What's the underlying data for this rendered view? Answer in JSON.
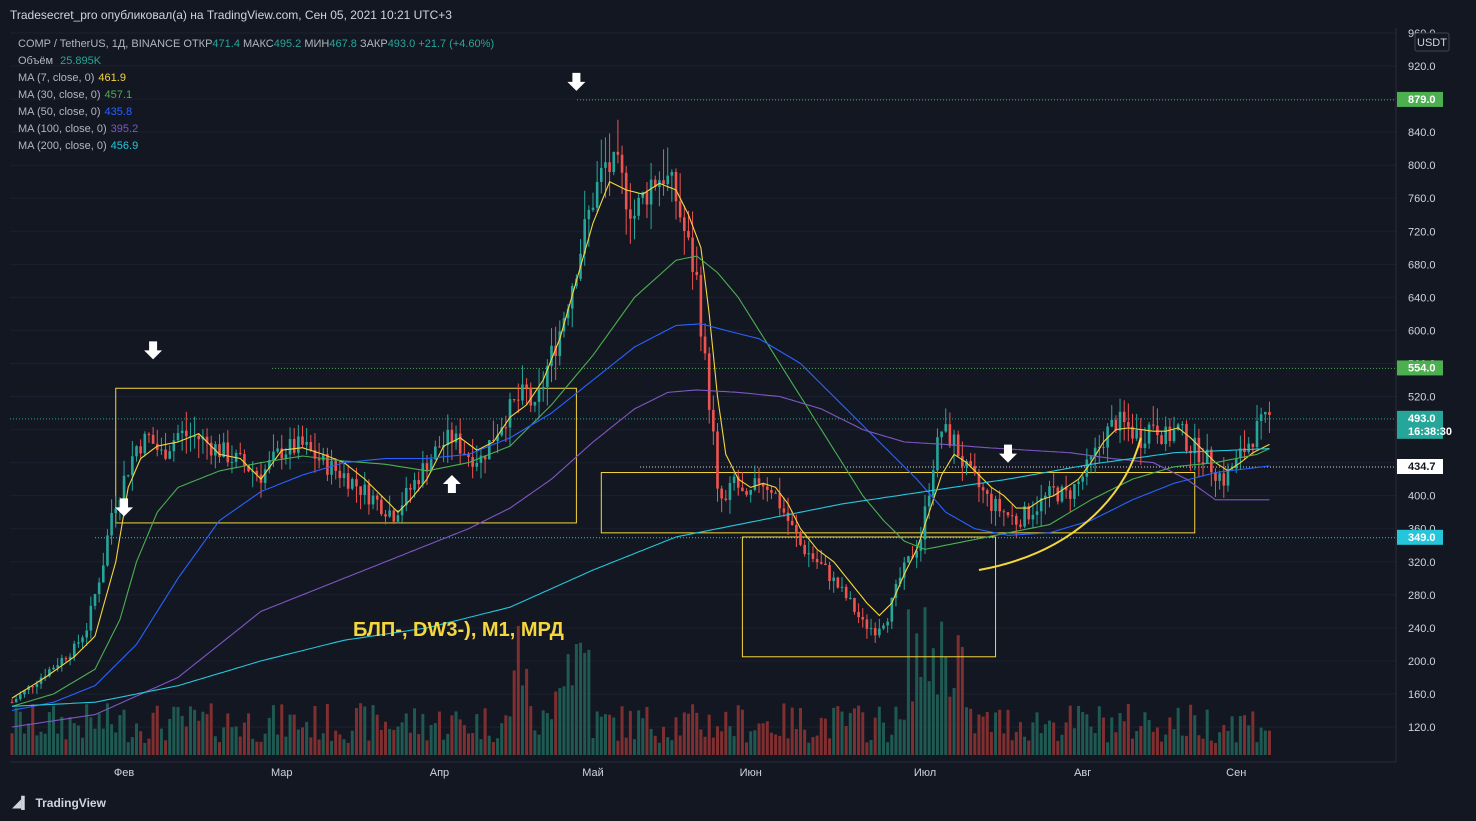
{
  "header": {
    "published": "Tradesecret_pro опубликовал(а) на TradingView.com, Сен 05, 2021 10:21 UTC+3"
  },
  "legend": {
    "symbol": "COMP / TetherUS, 1Д, BINANCE",
    "open_label": "ОТКР",
    "open": "471.4",
    "high_label": "МАКС",
    "high": "495.2",
    "low_label": "МИН",
    "low": "467.8",
    "close_label": "ЗАКР",
    "close": "493.0",
    "change": "+21.7 (+4.60%)",
    "volume_label": "Объём",
    "volume": "25.895K",
    "ma": [
      {
        "label": "MA (7, close, 0)",
        "value": "461.9",
        "color": "#f5d63d"
      },
      {
        "label": "MA (30, close, 0)",
        "value": "457.1",
        "color": "#4caf50"
      },
      {
        "label": "MA (50, close, 0)",
        "value": "435.8",
        "color": "#2962ff"
      },
      {
        "label": "MA (100, close, 0)",
        "value": "395.2",
        "color": "#7e57c2"
      },
      {
        "label": "MA (200, close, 0)",
        "value": "456.9",
        "color": "#26c6da"
      }
    ]
  },
  "annotation_text": "БЛП-, DW3-), M1, МРД",
  "footer": {
    "brand": "TradingView"
  },
  "chart_data": {
    "type": "candlestick",
    "currency": "USDT",
    "ylim": [
      90,
      960
    ],
    "y_ticks": [
      960,
      920,
      880,
      840,
      800,
      760,
      720,
      680,
      640,
      600,
      560,
      520,
      480,
      440,
      400,
      360,
      320,
      280,
      240,
      200,
      160,
      120
    ],
    "x_ticks": [
      "Фев",
      "Мар",
      "Апр",
      "Май",
      "Июн",
      "Июл",
      "Авг",
      "Сен"
    ],
    "price_labels": [
      {
        "value": "879.0",
        "color": "#4caf50"
      },
      {
        "value": "554.0",
        "color": "#4caf50"
      },
      {
        "value": "493.0",
        "sub": "16:38:30",
        "color": "#26a69a"
      },
      {
        "value": "434.7",
        "color": "#ffffff"
      },
      {
        "value": "349.0",
        "color": "#26c6da"
      }
    ],
    "horizontal_levels": [
      879,
      554,
      493,
      434.7,
      349
    ],
    "price_path": [
      [
        0,
        150
      ],
      [
        8,
        185
      ],
      [
        15,
        215
      ],
      [
        18,
        240
      ],
      [
        22,
        320
      ],
      [
        24,
        380
      ],
      [
        27,
        420
      ],
      [
        30,
        460
      ],
      [
        33,
        470
      ],
      [
        36,
        450
      ],
      [
        40,
        475
      ],
      [
        45,
        470
      ],
      [
        50,
        455
      ],
      [
        55,
        440
      ],
      [
        60,
        425
      ],
      [
        65,
        455
      ],
      [
        70,
        460
      ],
      [
        75,
        440
      ],
      [
        80,
        425
      ],
      [
        85,
        405
      ],
      [
        90,
        385
      ],
      [
        92,
        378
      ],
      [
        95,
        400
      ],
      [
        100,
        440
      ],
      [
        103,
        460
      ],
      [
        106,
        470
      ],
      [
        110,
        450
      ],
      [
        113,
        445
      ],
      [
        118,
        490
      ],
      [
        121,
        510
      ],
      [
        124,
        525
      ],
      [
        126,
        500
      ],
      [
        129,
        555
      ],
      [
        132,
        600
      ],
      [
        136,
        680
      ],
      [
        140,
        760
      ],
      [
        143,
        800
      ],
      [
        146,
        790
      ],
      [
        150,
        740
      ],
      [
        154,
        780
      ],
      [
        157,
        790
      ],
      [
        160,
        760
      ],
      [
        163,
        700
      ],
      [
        165,
        660
      ],
      [
        167,
        560
      ],
      [
        169,
        470
      ],
      [
        170,
        400
      ],
      [
        172,
        390
      ],
      [
        174,
        420
      ],
      [
        177,
        390
      ],
      [
        180,
        420
      ],
      [
        183,
        410
      ],
      [
        187,
        370
      ],
      [
        190,
        340
      ],
      [
        193,
        325
      ],
      [
        196,
        310
      ],
      [
        199,
        290
      ],
      [
        202,
        270
      ],
      [
        205,
        245
      ],
      [
        208,
        238
      ],
      [
        211,
        255
      ],
      [
        214,
        300
      ],
      [
        217,
        330
      ],
      [
        219,
        350
      ],
      [
        222,
        440
      ],
      [
        224,
        480
      ],
      [
        227,
        465
      ],
      [
        230,
        430
      ],
      [
        233,
        410
      ],
      [
        236,
        390
      ],
      [
        239,
        380
      ],
      [
        242,
        370
      ],
      [
        245,
        380
      ],
      [
        248,
        392
      ],
      [
        251,
        405
      ],
      [
        254,
        400
      ],
      [
        257,
        415
      ],
      [
        260,
        440
      ],
      [
        263,
        470
      ],
      [
        266,
        490
      ],
      [
        269,
        482
      ],
      [
        272,
        470
      ],
      [
        275,
        490
      ],
      [
        278,
        470
      ],
      [
        281,
        480
      ],
      [
        284,
        460
      ],
      [
        287,
        450
      ],
      [
        290,
        430
      ],
      [
        292,
        420
      ],
      [
        295,
        440
      ],
      [
        298,
        465
      ],
      [
        300,
        480
      ],
      [
        303,
        493
      ]
    ],
    "ma": {
      "ma7": [
        [
          0,
          155
        ],
        [
          8,
          180
        ],
        [
          15,
          205
        ],
        [
          20,
          230
        ],
        [
          25,
          320
        ],
        [
          28,
          410
        ],
        [
          31,
          445
        ],
        [
          35,
          460
        ],
        [
          40,
          465
        ],
        [
          45,
          475
        ],
        [
          50,
          450
        ],
        [
          55,
          445
        ],
        [
          60,
          420
        ],
        [
          65,
          455
        ],
        [
          70,
          458
        ],
        [
          75,
          450
        ],
        [
          80,
          440
        ],
        [
          85,
          420
        ],
        [
          90,
          395
        ],
        [
          93,
          380
        ],
        [
          96,
          395
        ],
        [
          100,
          420
        ],
        [
          104,
          460
        ],
        [
          108,
          470
        ],
        [
          112,
          455
        ],
        [
          116,
          465
        ],
        [
          120,
          495
        ],
        [
          124,
          510
        ],
        [
          128,
          540
        ],
        [
          132,
          590
        ],
        [
          136,
          660
        ],
        [
          140,
          730
        ],
        [
          144,
          780
        ],
        [
          148,
          770
        ],
        [
          152,
          765
        ],
        [
          156,
          778
        ],
        [
          160,
          770
        ],
        [
          163,
          740
        ],
        [
          166,
          700
        ],
        [
          168,
          620
        ],
        [
          170,
          520
        ],
        [
          172,
          450
        ],
        [
          175,
          420
        ],
        [
          178,
          410
        ],
        [
          181,
          415
        ],
        [
          184,
          410
        ],
        [
          187,
          390
        ],
        [
          190,
          360
        ],
        [
          194,
          335
        ],
        [
          198,
          320
        ],
        [
          202,
          295
        ],
        [
          206,
          270
        ],
        [
          209,
          255
        ],
        [
          212,
          270
        ],
        [
          215,
          305
        ],
        [
          218,
          335
        ],
        [
          221,
          380
        ],
        [
          224,
          425
        ],
        [
          227,
          450
        ],
        [
          230,
          440
        ],
        [
          233,
          425
        ],
        [
          236,
          410
        ],
        [
          239,
          400
        ],
        [
          242,
          385
        ],
        [
          245,
          385
        ],
        [
          248,
          395
        ],
        [
          251,
          400
        ],
        [
          254,
          410
        ],
        [
          257,
          420
        ],
        [
          260,
          440
        ],
        [
          263,
          465
        ],
        [
          266,
          480
        ],
        [
          269,
          482
        ],
        [
          272,
          480
        ],
        [
          275,
          478
        ],
        [
          278,
          478
        ],
        [
          281,
          482
        ],
        [
          284,
          470
        ],
        [
          287,
          455
        ],
        [
          290,
          440
        ],
        [
          293,
          430
        ],
        [
          296,
          440
        ],
        [
          299,
          452
        ],
        [
          303,
          462
        ]
      ],
      "ma30": [
        [
          0,
          145
        ],
        [
          10,
          160
        ],
        [
          20,
          190
        ],
        [
          26,
          250
        ],
        [
          30,
          320
        ],
        [
          35,
          380
        ],
        [
          40,
          410
        ],
        [
          50,
          430
        ],
        [
          60,
          440
        ],
        [
          70,
          448
        ],
        [
          80,
          442
        ],
        [
          90,
          438
        ],
        [
          100,
          430
        ],
        [
          110,
          440
        ],
        [
          120,
          460
        ],
        [
          130,
          510
        ],
        [
          140,
          570
        ],
        [
          150,
          640
        ],
        [
          160,
          685
        ],
        [
          165,
          690
        ],
        [
          170,
          670
        ],
        [
          175,
          640
        ],
        [
          180,
          600
        ],
        [
          185,
          560
        ],
        [
          190,
          520
        ],
        [
          195,
          480
        ],
        [
          200,
          440
        ],
        [
          205,
          400
        ],
        [
          210,
          370
        ],
        [
          215,
          345
        ],
        [
          220,
          335
        ],
        [
          225,
          340
        ],
        [
          230,
          345
        ],
        [
          240,
          355
        ],
        [
          250,
          365
        ],
        [
          260,
          395
        ],
        [
          270,
          420
        ],
        [
          280,
          435
        ],
        [
          290,
          440
        ],
        [
          300,
          450
        ],
        [
          303,
          457
        ]
      ],
      "ma50": [
        [
          0,
          140
        ],
        [
          10,
          150
        ],
        [
          20,
          170
        ],
        [
          30,
          220
        ],
        [
          40,
          300
        ],
        [
          50,
          370
        ],
        [
          60,
          405
        ],
        [
          70,
          425
        ],
        [
          80,
          440
        ],
        [
          90,
          445
        ],
        [
          100,
          445
        ],
        [
          110,
          450
        ],
        [
          120,
          470
        ],
        [
          130,
          500
        ],
        [
          140,
          540
        ],
        [
          150,
          580
        ],
        [
          160,
          606
        ],
        [
          166,
          608
        ],
        [
          172,
          600
        ],
        [
          180,
          590
        ],
        [
          190,
          560
        ],
        [
          200,
          510
        ],
        [
          210,
          460
        ],
        [
          218,
          420
        ],
        [
          225,
          380
        ],
        [
          232,
          360
        ],
        [
          240,
          352
        ],
        [
          250,
          355
        ],
        [
          260,
          370
        ],
        [
          270,
          395
        ],
        [
          280,
          415
        ],
        [
          290,
          428
        ],
        [
          303,
          436
        ]
      ],
      "ma100": [
        [
          0,
          120
        ],
        [
          20,
          135
        ],
        [
          40,
          180
        ],
        [
          60,
          260
        ],
        [
          80,
          300
        ],
        [
          100,
          340
        ],
        [
          110,
          360
        ],
        [
          120,
          385
        ],
        [
          130,
          420
        ],
        [
          140,
          465
        ],
        [
          150,
          505
        ],
        [
          158,
          525
        ],
        [
          165,
          528
        ],
        [
          175,
          525
        ],
        [
          185,
          520
        ],
        [
          195,
          505
        ],
        [
          205,
          480
        ],
        [
          215,
          465
        ],
        [
          225,
          462
        ],
        [
          235,
          458
        ],
        [
          245,
          455
        ],
        [
          255,
          452
        ],
        [
          265,
          445
        ],
        [
          275,
          440
        ],
        [
          283,
          420
        ],
        [
          290,
          395
        ],
        [
          303,
          395
        ]
      ],
      "ma200": [
        [
          0,
          145
        ],
        [
          20,
          150
        ],
        [
          40,
          170
        ],
        [
          60,
          200
        ],
        [
          80,
          225
        ],
        [
          100,
          240
        ],
        [
          120,
          265
        ],
        [
          140,
          310
        ],
        [
          160,
          350
        ],
        [
          170,
          360
        ],
        [
          180,
          370
        ],
        [
          200,
          390
        ],
        [
          220,
          405
        ],
        [
          240,
          420
        ],
        [
          260,
          438
        ],
        [
          280,
          452
        ],
        [
          303,
          457
        ]
      ]
    },
    "boxes": [
      {
        "t0": 25,
        "t1": 136,
        "p0": 367,
        "p1": 530
      },
      {
        "t0": 142,
        "t1": 285,
        "p0": 355,
        "p1": 428
      },
      {
        "t0": 176,
        "t1": 237,
        "p0": 205,
        "p1": 350
      }
    ],
    "arrows": [
      {
        "t": 34,
        "p": 565,
        "dir": "down"
      },
      {
        "t": 27,
        "p": 375,
        "dir": "down"
      },
      {
        "t": 136,
        "p": 890,
        "dir": "down"
      },
      {
        "t": 106,
        "p": 425,
        "dir": "up"
      },
      {
        "t": 240,
        "p": 440,
        "dir": "down"
      }
    ],
    "curve": [
      [
        233,
        310
      ],
      [
        255,
        330
      ],
      [
        268,
        395
      ],
      [
        272,
        470
      ]
    ]
  }
}
